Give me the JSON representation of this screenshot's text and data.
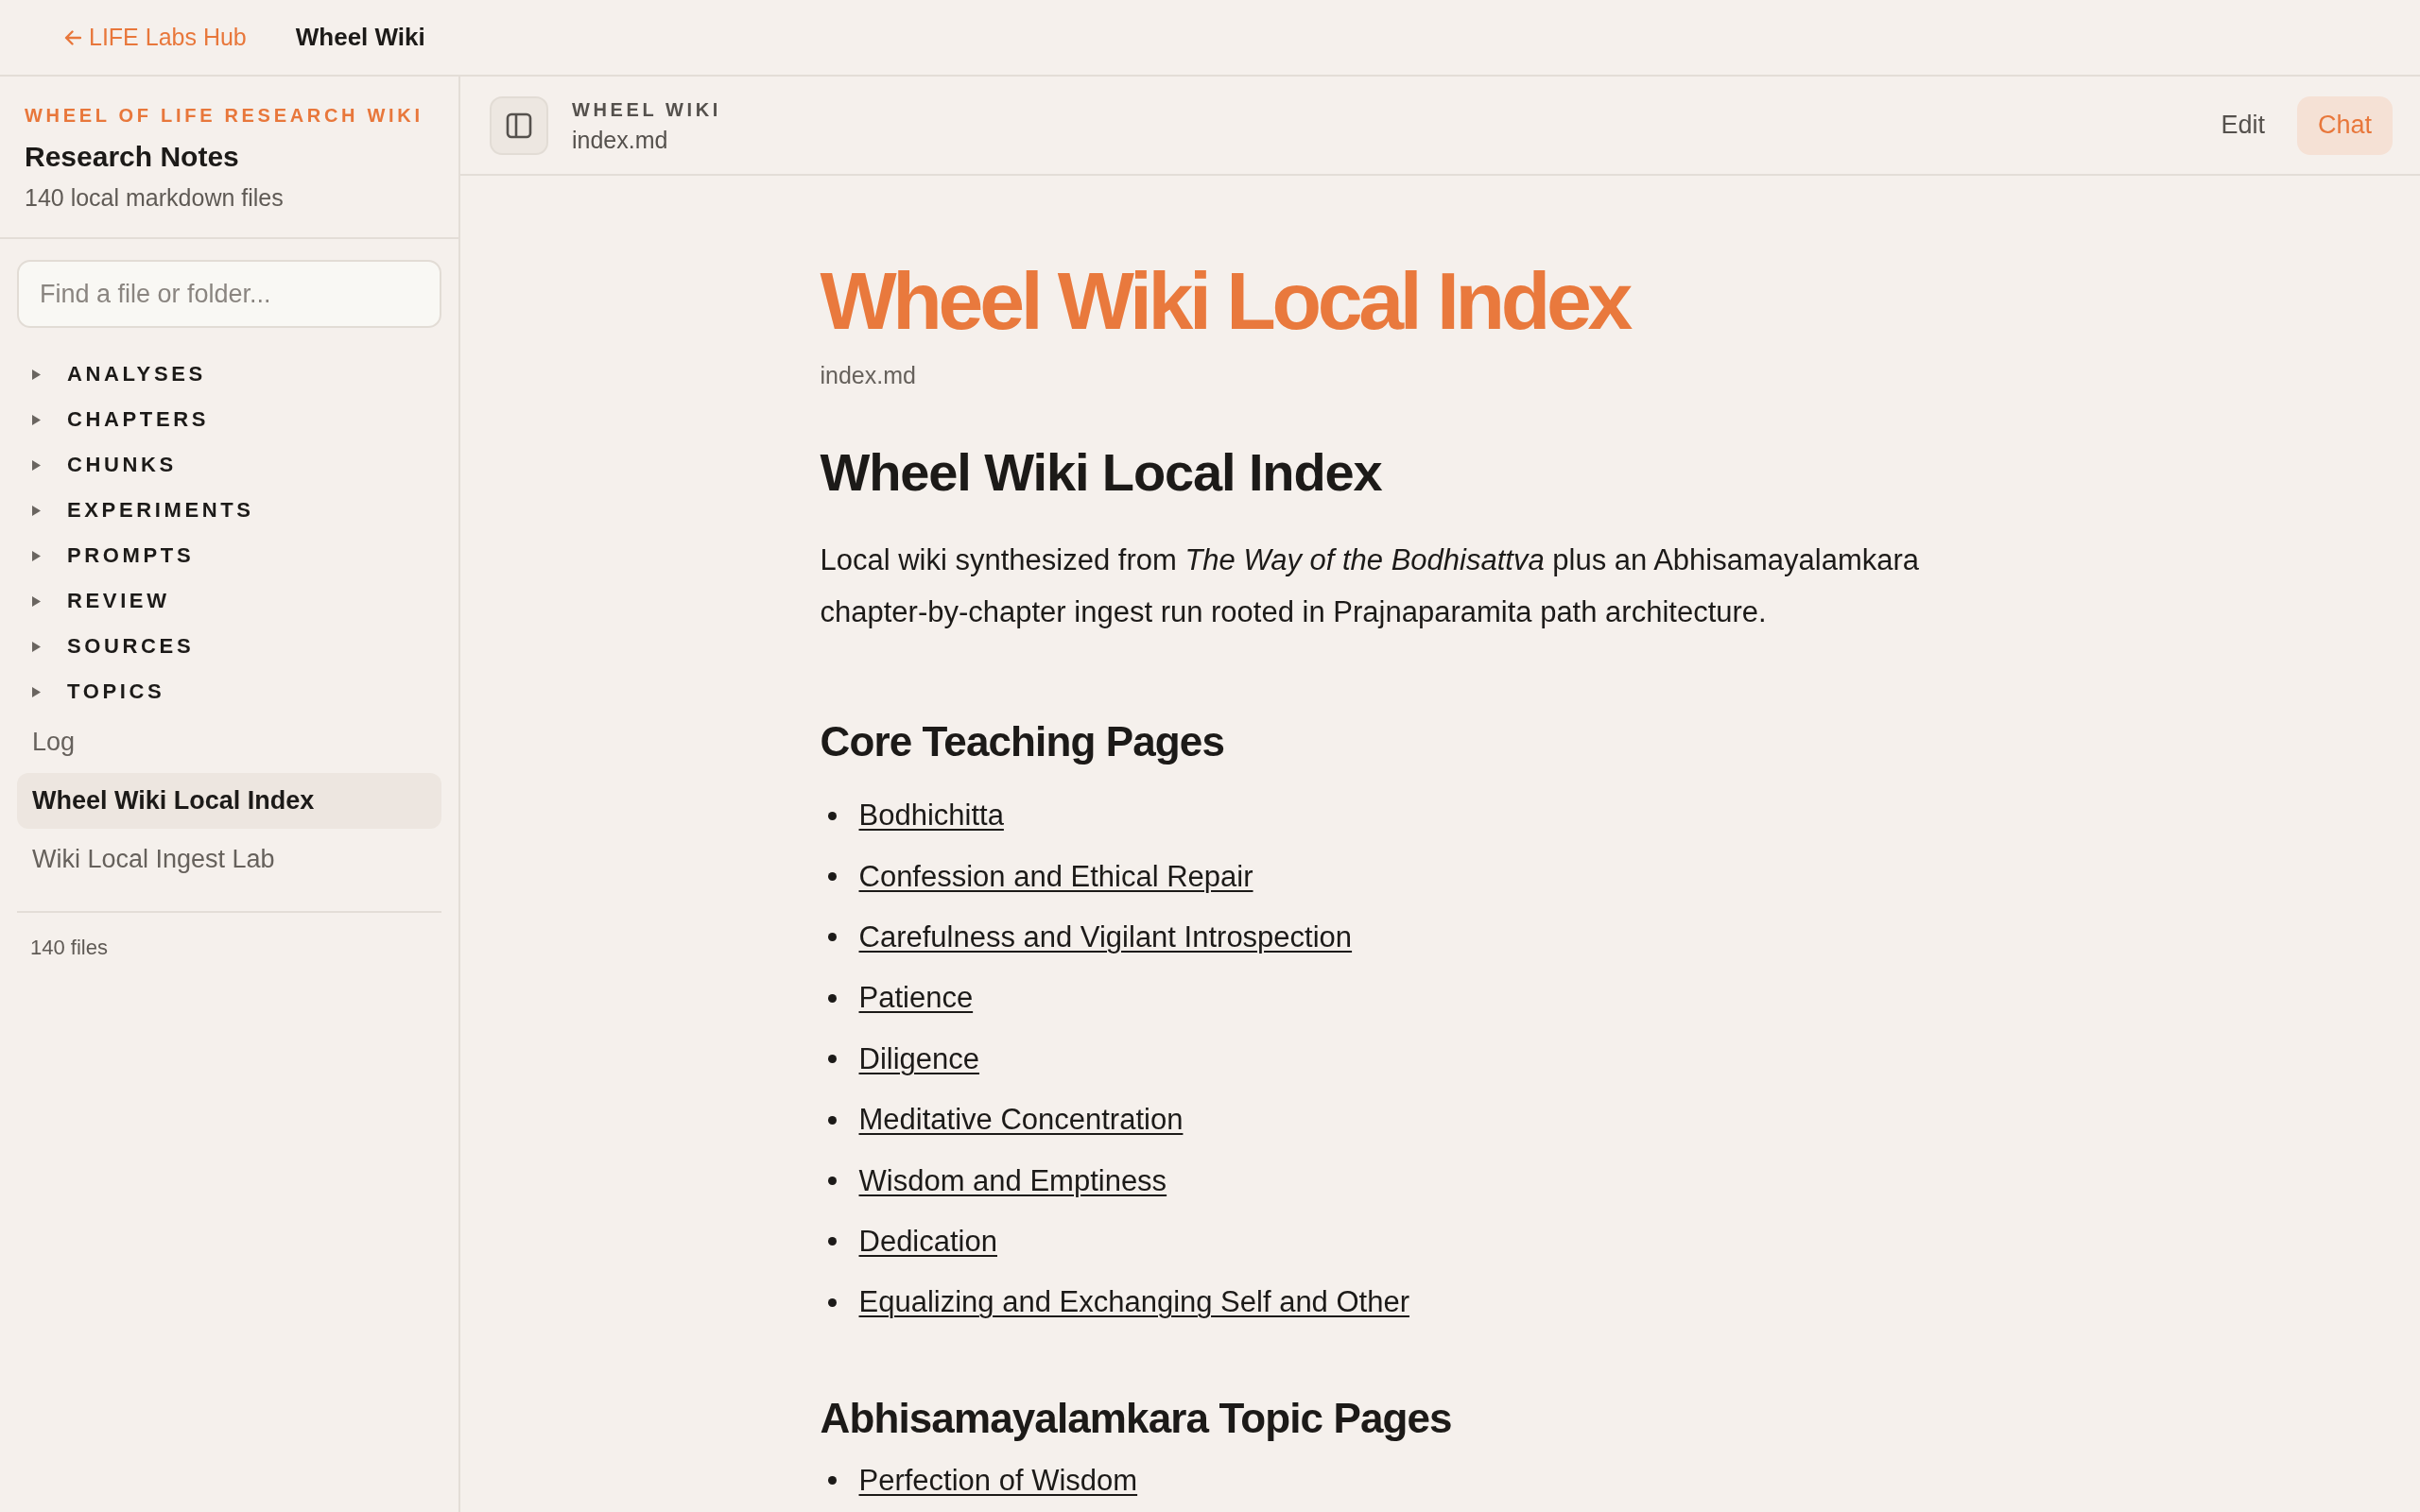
{
  "top_bar": {
    "back_link": "LIFE Labs Hub",
    "title": "Wheel Wiki"
  },
  "sidebar": {
    "eyebrow": "WHEEL OF LIFE RESEARCH WIKI",
    "title": "Research Notes",
    "subtitle": "140 local markdown files",
    "search": {
      "placeholder": "Find a file or folder..."
    },
    "folders": [
      {
        "label": "ANALYSES",
        "expanded": false
      },
      {
        "label": "CHAPTERS",
        "expanded": false
      },
      {
        "label": "CHUNKS",
        "expanded": false
      },
      {
        "label": "EXPERIMENTS",
        "expanded": false
      },
      {
        "label": "PROMPTS",
        "expanded": false
      },
      {
        "label": "REVIEW",
        "expanded": false
      },
      {
        "label": "SOURCES",
        "expanded": false
      },
      {
        "label": "TOPICS",
        "expanded": false
      }
    ],
    "pages": [
      {
        "label": "Log",
        "selected": false
      },
      {
        "label": "Wheel Wiki Local Index",
        "selected": true
      },
      {
        "label": "Wiki Local Ingest Lab",
        "selected": false
      }
    ],
    "footer": "140 files"
  },
  "header": {
    "section": "WHEEL WIKI",
    "file": "index.md",
    "buttons": [
      {
        "label": "Edit",
        "selected": false
      },
      {
        "label": "Chat",
        "selected": true
      }
    ]
  },
  "document": {
    "title": "Wheel Wiki Local Index",
    "path": "index.md",
    "heading": "Wheel Wiki Local Index",
    "intro": "Local wiki synthesized from *The Way of the Bodhisattva* plus an Abhisamayalamkara chapter-by-chapter ingest run rooted in Prajnaparamita path architecture.",
    "sections": [
      {
        "heading": "Core Teaching Pages",
        "links": [
          "Bodhichitta",
          "Confession and Ethical Repair",
          "Carefulness and Vigilant Introspection",
          "Patience",
          "Diligence",
          "Meditative Concentration",
          "Wisdom and Emptiness",
          "Dedication",
          "Equalizing and Exchanging Self and Other"
        ]
      },
      {
        "heading": "Abhisamayalamkara Topic Pages",
        "links": [
          "Perfection of Wisdom"
        ]
      }
    ]
  }
}
